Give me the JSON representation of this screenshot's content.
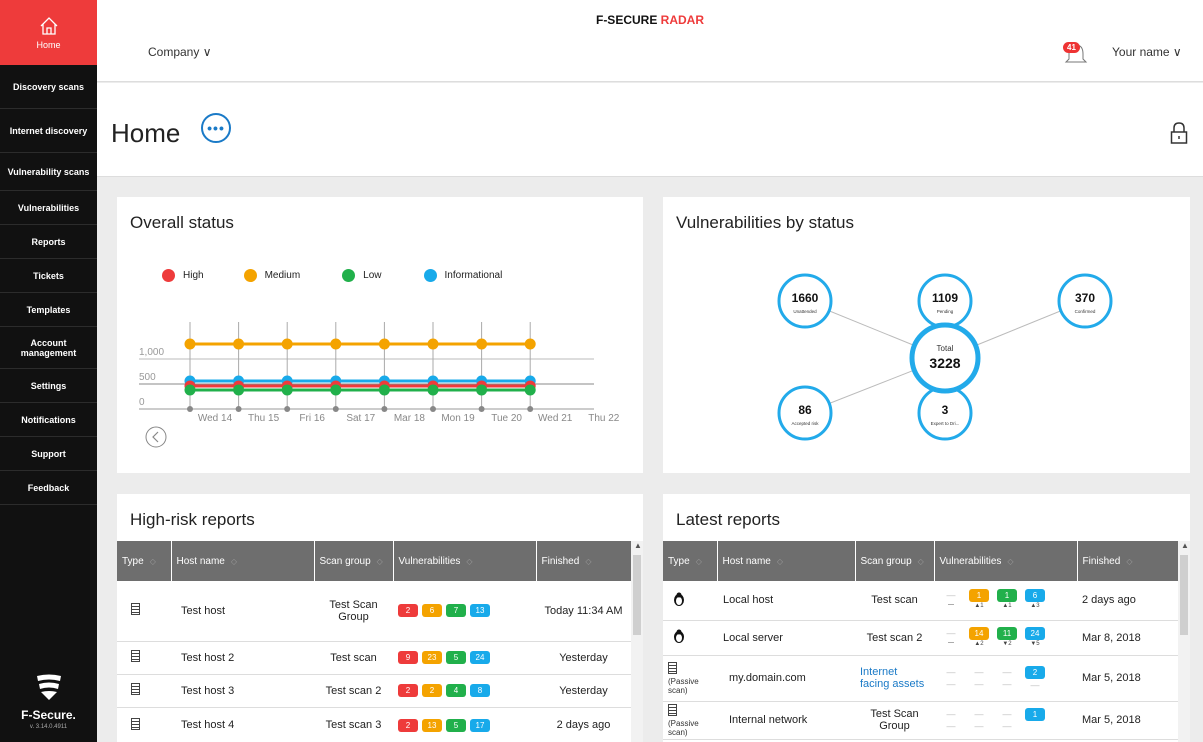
{
  "sidebar": {
    "home": "Home",
    "items": [
      {
        "label": "Discovery scans",
        "name": "sidebar-item-discovery-scans",
        "h": 44
      },
      {
        "label": "Internet discovery",
        "name": "sidebar-item-internet-discovery",
        "h": 44
      },
      {
        "label": "Vulnerability scans",
        "name": "sidebar-item-vulnerability-scans",
        "h": 38
      },
      {
        "label": "Vulnerabilities",
        "name": "sidebar-item-vulnerabilities",
        "h": 34
      },
      {
        "label": "Reports",
        "name": "sidebar-item-reports",
        "h": 34
      },
      {
        "label": "Tickets",
        "name": "sidebar-item-tickets",
        "h": 34
      },
      {
        "label": "Templates",
        "name": "sidebar-item-templates",
        "h": 34
      },
      {
        "label": "Account management",
        "name": "sidebar-item-account-management",
        "h": 42
      },
      {
        "label": "Settings",
        "name": "sidebar-item-settings",
        "h": 34
      },
      {
        "label": "Notifications",
        "name": "sidebar-item-notifications",
        "h": 34
      },
      {
        "label": "Support",
        "name": "sidebar-item-support",
        "h": 34
      },
      {
        "label": "Feedback",
        "name": "sidebar-item-feedback",
        "h": 34
      }
    ],
    "brand": "F-Secure.",
    "version": "v. 3.14.0.4911"
  },
  "header": {
    "product_a": "F-SECURE ",
    "product_b": "RADAR",
    "company": "Company ∨",
    "notification_count": "41",
    "user": "Your name ∨"
  },
  "page": {
    "title": "Home",
    "more": "•••"
  },
  "overall": {
    "title": "Overall status",
    "legend": [
      {
        "label": "High",
        "color": "#ee3b3b"
      },
      {
        "label": "Medium",
        "color": "#f4a300"
      },
      {
        "label": "Low",
        "color": "#21b04b"
      },
      {
        "label": "Informational",
        "color": "#18aaea"
      }
    ]
  },
  "chart_data": {
    "type": "line",
    "x": [
      "Wed 14",
      "Thu 15",
      "Fri 16",
      "Sat 17",
      "Mar 18",
      "Mon 19",
      "Tue 20",
      "Wed 21",
      "Thu 22"
    ],
    "yticks": [
      "1,000",
      "500",
      "0"
    ],
    "ylim": [
      0,
      1000
    ],
    "series": [
      {
        "name": "Medium",
        "color": "#f4a300",
        "values": [
          1300,
          1300,
          1300,
          1300,
          1300,
          1300,
          1300,
          1300
        ]
      },
      {
        "name": "Informational",
        "color": "#18aaea",
        "values": [
          560,
          560,
          560,
          560,
          560,
          560,
          560,
          560
        ]
      },
      {
        "name": "High",
        "color": "#ee3b3b",
        "values": [
          460,
          460,
          460,
          460,
          460,
          460,
          460,
          460
        ]
      },
      {
        "name": "Low",
        "color": "#21b04b",
        "values": [
          380,
          380,
          380,
          380,
          380,
          380,
          380,
          380
        ]
      }
    ]
  },
  "vuln_status": {
    "title": "Vulnerabilities by status",
    "total_label": "Total",
    "total_value": "3228",
    "nodes": [
      {
        "value": "1660",
        "label": "Unattended"
      },
      {
        "value": "1109",
        "label": "Pending"
      },
      {
        "value": "370",
        "label": "Confirmed"
      },
      {
        "value": "86",
        "label": "Accepted risk"
      },
      {
        "value": "3",
        "label": "Expert to Dri..."
      }
    ]
  },
  "highrisk": {
    "title": "High-risk reports",
    "headers": [
      "Type",
      "Host name",
      "Scan group",
      "Vulnerabilities",
      "Finished"
    ],
    "rows": [
      {
        "host": "Test host",
        "group": "Test Scan Group",
        "v": [
          "2",
          "6",
          "7",
          "13"
        ],
        "finished": "Today 11:34 AM"
      },
      {
        "host": "Test host 2",
        "group": "Test scan",
        "v": [
          "9",
          "23",
          "5",
          "24"
        ],
        "finished": "Yesterday"
      },
      {
        "host": "Test host 3",
        "group": "Test scan 2",
        "v": [
          "2",
          "2",
          "4",
          "8"
        ],
        "finished": "Yesterday"
      },
      {
        "host": "Test host 4",
        "group": "Test scan 3",
        "v": [
          "2",
          "13",
          "5",
          "17"
        ],
        "finished": "2 days ago"
      }
    ]
  },
  "latest": {
    "title": "Latest reports",
    "headers": [
      "Type",
      "Host name",
      "Scan group",
      "Vulnerabilities",
      "Finished"
    ],
    "passive": "(Passive scan)",
    "rows": [
      {
        "host": "Local host",
        "group": "Test scan",
        "v": [
          "1",
          "1",
          "6"
        ],
        "d": [
          "▲1",
          "▲1",
          "▲3"
        ],
        "finished": "2 days ago"
      },
      {
        "host": "Local server",
        "group": "Test scan 2",
        "v": [
          "14",
          "11",
          "24"
        ],
        "d": [
          "▲2",
          "▼2",
          "▼5"
        ],
        "finished": "Mar 8, 2018"
      },
      {
        "host": "my.domain.com",
        "group": "Internet facing assets",
        "v": [
          "2"
        ],
        "finished": "Mar 5, 2018"
      },
      {
        "host": "Internal network",
        "group": "Test Scan Group",
        "v": [
          "1"
        ],
        "finished": "Mar 5, 2018"
      }
    ]
  }
}
